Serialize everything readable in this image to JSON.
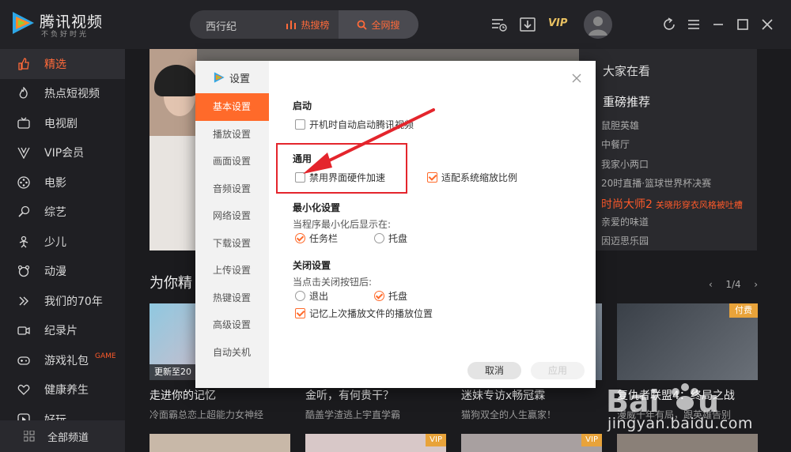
{
  "app": {
    "brand": "腾讯视频",
    "brand_sub": "不负好时光"
  },
  "search": {
    "value": "西行纪",
    "hot_label": "热搜榜",
    "all_label": "全网搜"
  },
  "toolbar": {
    "vip_label": "VIP"
  },
  "sidebar": {
    "items": [
      {
        "label": "精选",
        "icon": "thumb-up-icon",
        "active": true
      },
      {
        "label": "热点短视频",
        "icon": "flame-icon"
      },
      {
        "label": "电视剧",
        "icon": "tv-icon"
      },
      {
        "label": "VIP会员",
        "icon": "vip-v-icon"
      },
      {
        "label": "电影",
        "icon": "film-reel-icon"
      },
      {
        "label": "综艺",
        "icon": "microphone-icon"
      },
      {
        "label": "少儿",
        "icon": "kid-icon"
      },
      {
        "label": "动漫",
        "icon": "bear-icon"
      },
      {
        "label": "我们的70年",
        "icon": "double-chevron-icon"
      },
      {
        "label": "纪录片",
        "icon": "camera-icon"
      },
      {
        "label": "游戏礼包",
        "icon": "gamepad-icon",
        "tag": "GAME"
      },
      {
        "label": "健康养生",
        "icon": "heart-icon"
      },
      {
        "label": "好玩",
        "icon": "play-icon"
      }
    ],
    "all_channels": "全部频道"
  },
  "hot_panel": {
    "title": "大家在看",
    "subtitle": "重磅推荐",
    "items": [
      "鼠胆英雄",
      "中餐厅",
      "我家小两口",
      "20时直播·篮球世界杯决赛",
      {
        "main": "时尚大师2",
        "extra": "关晓彤穿衣风格被吐槽"
      },
      "亲爱的味道",
      "因迈思乐园"
    ]
  },
  "section": {
    "title": "为你精",
    "pager": "1/4"
  },
  "cards": [
    {
      "title": "走进你的记忆",
      "desc": "冷面霸总恋上超能力女神经",
      "update": "更新至20"
    },
    {
      "title": "金听，有何贵干？",
      "desc": "酷盖学渣逃上宇直学霸"
    },
    {
      "title": "迷妹专访x畅冠霖",
      "desc": "猫狗双全的人生赢家！"
    },
    {
      "title": "复仇者联盟4：终局之战",
      "desc": "漫威十年有局，跟英雄告别",
      "badge": "付费"
    }
  ],
  "bottom_cards": [
    {
      "badge": ""
    },
    {
      "badge": "VIP"
    },
    {
      "badge": "VIP"
    },
    {
      "badge": ""
    }
  ],
  "dialog": {
    "title": "设置",
    "nav": [
      "基本设置",
      "播放设置",
      "画面设置",
      "音频设置",
      "网络设置",
      "下载设置",
      "上传设置",
      "热键设置",
      "高级设置",
      "自动关机"
    ],
    "startup": {
      "heading": "启动",
      "autostart_label": "开机时自动启动腾讯视频",
      "autostart_checked": false
    },
    "general": {
      "heading": "通用",
      "hw_accel_label": "禁用界面硬件加速",
      "hw_accel_checked": false,
      "scale_label": "适配系统缩放比例",
      "scale_checked": true
    },
    "minimize": {
      "heading": "最小化设置",
      "hint": "当程序最小化后显示在:",
      "taskbar_label": "任务栏",
      "tray_label": "托盘",
      "selected": "任务栏"
    },
    "close": {
      "heading": "关闭设置",
      "hint": "当点击关闭按钮后:",
      "exit_label": "退出",
      "tray_label": "托盘",
      "selected": "托盘",
      "remember_label": "记忆上次播放文件的播放位置",
      "remember_checked": true
    },
    "cancel_label": "取消",
    "apply_label": "应用"
  },
  "watermark": {
    "url": "jingyan.baidu.com"
  },
  "colors": {
    "accent": "#ff6a2a",
    "annotation": "#e4252c",
    "vip_gold": "#e8c061"
  }
}
